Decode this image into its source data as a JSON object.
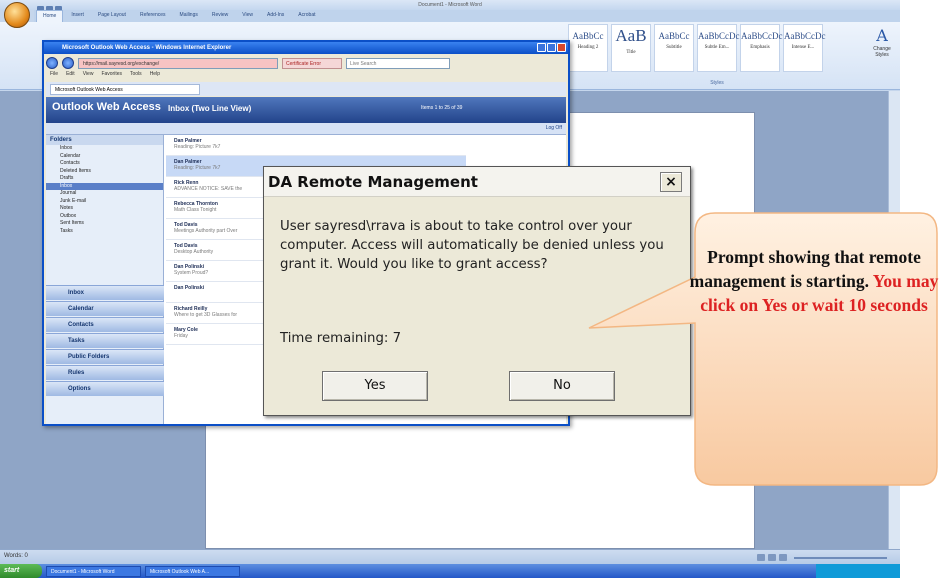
{
  "word": {
    "title": "Document1 - Microsoft Word",
    "tabs": [
      "Home",
      "Insert",
      "Page Layout",
      "References",
      "Mailings",
      "Review",
      "View",
      "Add-Ins",
      "Acrobat"
    ],
    "styles": [
      {
        "sample": "AaBbCc",
        "name": "Heading 2"
      },
      {
        "sample": "AaB",
        "name": "Title"
      },
      {
        "sample": "AaBbCc",
        "name": "Subtitle"
      },
      {
        "sample": "AaBbCcDc",
        "name": "Subtle Em..."
      },
      {
        "sample": "AaBbCcDc",
        "name": "Emphasis"
      },
      {
        "sample": "AaBbCcDc",
        "name": "Intense E..."
      }
    ],
    "change_styles_label": "Change Styles",
    "styles_group_label": "Styles",
    "status_page": "Words: 0"
  },
  "ie": {
    "title": "Microsoft Outlook Web Access - Windows Internet Explorer",
    "url": "https://mail.sayresd.org/exchange/",
    "cert_error": "Certificate Error",
    "search_placeholder": "Live Search",
    "menu": [
      "File",
      "Edit",
      "View",
      "Favorites",
      "Tools",
      "Help"
    ],
    "tab_label": "Microsoft Outlook Web Access"
  },
  "owa": {
    "logo": "Outlook Web Access",
    "inbox_title": "Inbox (Two Line View)",
    "items_text": "Items 1 to 25 of 39",
    "logoff": "Log Off",
    "folders_header": "Folders",
    "folders": [
      "Inbox",
      "Calendar",
      "Contacts",
      "Deleted Items",
      "Drafts",
      "Inbox",
      "Journal",
      "Junk E-mail",
      "Notes",
      "Outbox",
      "Sent Items",
      "Tasks"
    ],
    "nav_buttons": [
      "Inbox",
      "Calendar",
      "Contacts",
      "Tasks",
      "Public Folders",
      "Rules",
      "Options"
    ],
    "messages": [
      {
        "from": "Dan Palmer",
        "subject": "Reading: Picture 7k7"
      },
      {
        "from": "Dan Palmer",
        "subject": "Reading: Picture 7k7"
      },
      {
        "from": "Rick Renn",
        "subject": "ADVANCE NOTICE: SAVE the"
      },
      {
        "from": "Rebecca Thornton",
        "subject": "Math Class Tonight"
      },
      {
        "from": "Tod Davis",
        "subject": "Meetings Authority part Over"
      },
      {
        "from": "Tod Davis",
        "subject": "Desktop Authority"
      },
      {
        "from": "Dan Polinski",
        "subject": "System Proud?"
      },
      {
        "from": "Dan Polinski",
        "subject": ""
      },
      {
        "from": "Richard Reilly",
        "subject": "Where to get 3D Glasses for"
      },
      {
        "from": "Mary Cole",
        "subject": "Friday"
      }
    ]
  },
  "dialog": {
    "title": "DA Remote Management",
    "close_label": "×",
    "message": "User sayresd\\rrava is about to take control over your computer. Access will automatically be denied unless you grant it.  Would you like to grant access?",
    "time_label": "Time remaining: 7",
    "yes_label": "Yes",
    "no_label": "No"
  },
  "callout": {
    "text_black": "Prompt showing that remote management is starting.",
    "text_red": "You may click on Yes or wait 10 seconds",
    "fill_color": "#fde0c4",
    "border_color": "#f3b783"
  },
  "taskbar": {
    "start": "start",
    "items": [
      "Document1 - Microsoft Word",
      "Microsoft Outlook Web A..."
    ]
  },
  "colors": {
    "word_ribbon": "#d5e3f5",
    "owa_header": "#22438a",
    "url_error_bg": "#f7c3c3",
    "dialog_bg": "#ece9d8",
    "callout_red": "#dd2222"
  }
}
